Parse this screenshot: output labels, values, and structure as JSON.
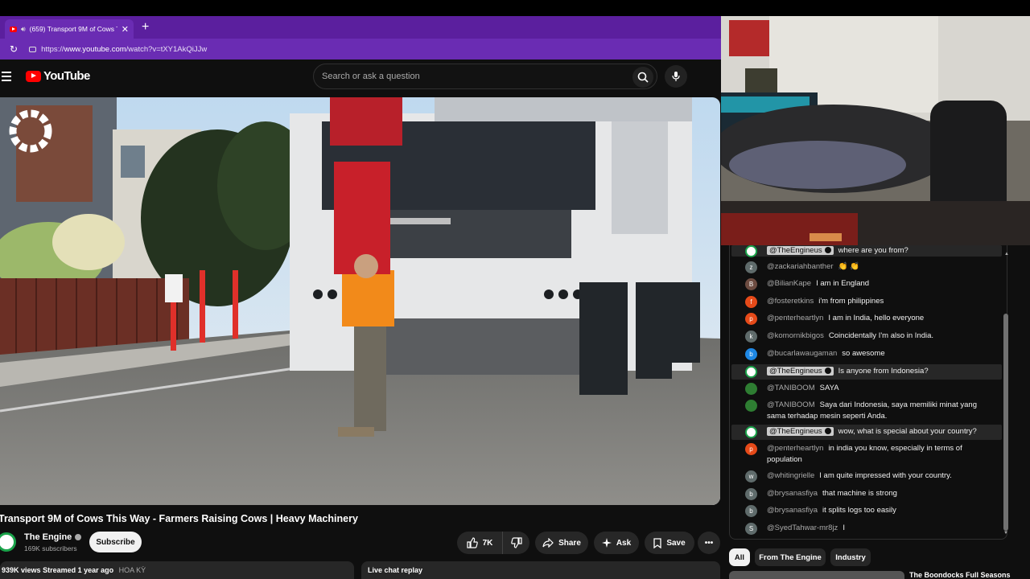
{
  "browser": {
    "tab_title": "(659) Transport 9M of Cows Th",
    "url_scheme": "https://",
    "url_host": "www.youtube.com",
    "url_path": "/watch?v=tXY1AkQiJJw"
  },
  "header": {
    "logo_text": "YouTube",
    "search_placeholder": "Search or ask a question"
  },
  "video": {
    "title": "Transport 9M of Cows This Way - Farmers Raising Cows | Heavy Machinery",
    "channel_name": "The Engine",
    "subscribers": "169K subscribers",
    "subscribe_label": "Subscribe",
    "likes": "7K",
    "share_label": "Share",
    "ask_label": "Ask",
    "save_label": "Save",
    "views": "939K views",
    "streamed": "Streamed 1 year ago",
    "location": "HOA KỲ",
    "live_chat_replay": "Live chat replay"
  },
  "chat": {
    "messages": [
      {
        "author": "@TheEngineus",
        "owner": true,
        "text": "where are you from?",
        "avatar": "",
        "color": "#ffffff"
      },
      {
        "author": "@zackariahbanther",
        "text": "👏 👏",
        "avatar": "z",
        "color": "#5f6b6b"
      },
      {
        "author": "@BilianKape",
        "text": "I am in England",
        "avatar": "B",
        "color": "#6d4c41"
      },
      {
        "author": "@fosteretkins",
        "text": "i'm from philippines",
        "avatar": "f",
        "color": "#e64a19"
      },
      {
        "author": "@penterheartlyn",
        "text": "I am in India, hello everyone",
        "avatar": "p",
        "color": "#e64a19"
      },
      {
        "author": "@komornikbigos",
        "text": "Coincidentally I'm also in India.",
        "avatar": "k",
        "color": "#5f6b6b"
      },
      {
        "author": "@bucarlawaugaman",
        "text": "so awesome",
        "avatar": "b",
        "color": "#1e88e5"
      },
      {
        "author": "@TheEngineus",
        "owner": true,
        "text": "Is anyone from Indonesia?",
        "avatar": "",
        "color": "#ffffff"
      },
      {
        "author": "@TANIBOOM",
        "text": "SAYA",
        "avatar": "",
        "color": "#2e7d32"
      },
      {
        "author": "@TANIBOOM",
        "text": "Saya dari Indonesia, saya memiliki minat yang sama terhadap mesin seperti Anda.",
        "avatar": "",
        "color": "#2e7d32"
      },
      {
        "author": "@TheEngineus",
        "owner": true,
        "text": "wow, what is special about your country?",
        "avatar": "",
        "color": "#ffffff"
      },
      {
        "author": "@penterheartlyn",
        "text": "in india you know, especially in terms of population",
        "avatar": "p",
        "color": "#e64a19"
      },
      {
        "author": "@whitingrielle",
        "text": "I am quite impressed with your country.",
        "avatar": "w",
        "color": "#5f6b6b"
      },
      {
        "author": "@brysanasfiya",
        "text": "that machine is strong",
        "avatar": "b",
        "color": "#5f6b6b"
      },
      {
        "author": "@brysanasfiya",
        "text": "it splits logs too easily",
        "avatar": "b",
        "color": "#5f6b6b"
      },
      {
        "author": "@SyedTahwar-mr8jz",
        "text": "I",
        "avatar": "S",
        "color": "#5f6b6b"
      }
    ],
    "chips": [
      "All",
      "From The Engine",
      "Industry"
    ],
    "next_title": "The Boondocks Full Seasons"
  },
  "colors": {
    "tab_purple": "#6a2cb3",
    "youtube_red": "#ff0000",
    "background": "#0f0f0f",
    "channel_green": "#1aa34a"
  }
}
